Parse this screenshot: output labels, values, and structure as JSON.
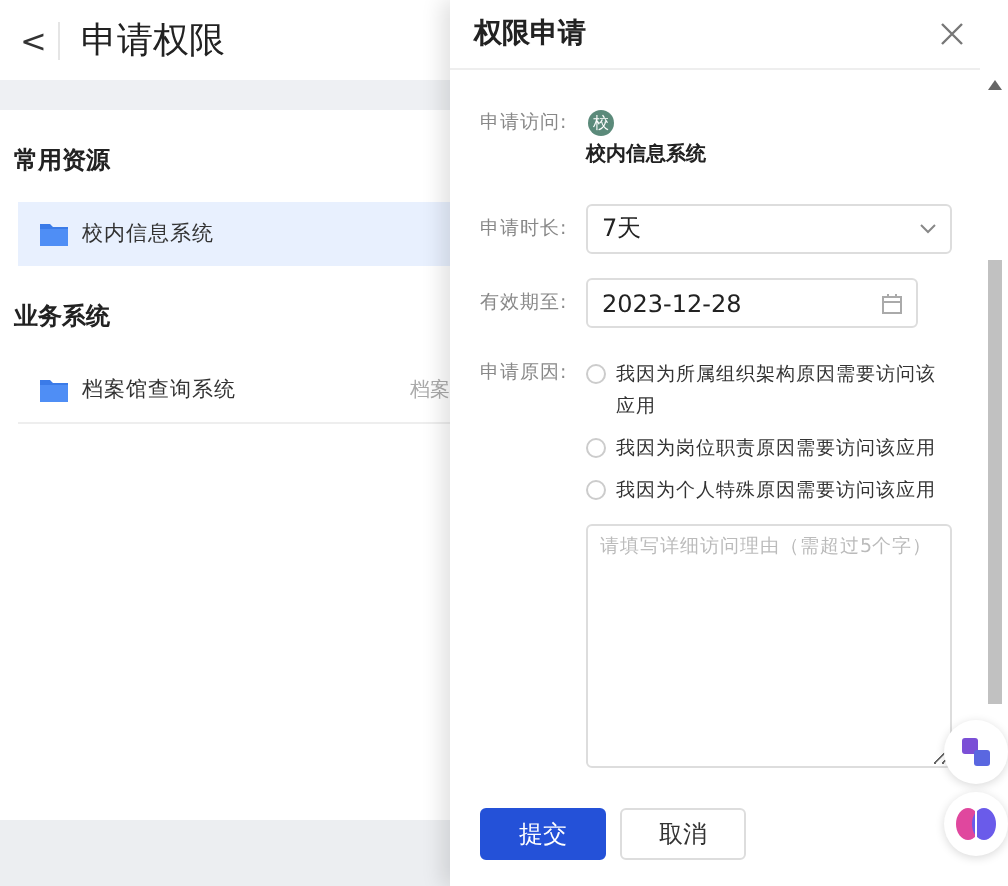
{
  "page": {
    "back_icon": "<",
    "title": "申请权限"
  },
  "sections": [
    {
      "title": "常用资源",
      "items": [
        {
          "name": "校内信息系统",
          "selected": true
        }
      ]
    },
    {
      "title": "业务系统",
      "items": [
        {
          "name": "档案馆查询系统",
          "side_text": "档案",
          "selected": false
        }
      ]
    }
  ],
  "drawer": {
    "title": "权限申请",
    "access": {
      "label": "申请访问:",
      "avatar_text": "校",
      "name": "校内信息系统"
    },
    "duration": {
      "label": "申请时长:",
      "value": "7天"
    },
    "expiry": {
      "label": "有效期至:",
      "value": "2023-12-28"
    },
    "reason": {
      "label": "申请原因:",
      "options": [
        {
          "label": "我因为所属组织架构原因需要访问该应用",
          "selected": false
        },
        {
          "label": "我因为岗位职责原因需要访问该应用",
          "selected": false
        },
        {
          "label": "我因为个人特殊原因需要访问该应用",
          "selected": false
        }
      ],
      "placeholder": "请填写详细访问理由（需超过5个字）"
    },
    "buttons": [
      {
        "label": "提交",
        "kind": "primary"
      },
      {
        "label": "取消",
        "kind": "default"
      }
    ]
  }
}
